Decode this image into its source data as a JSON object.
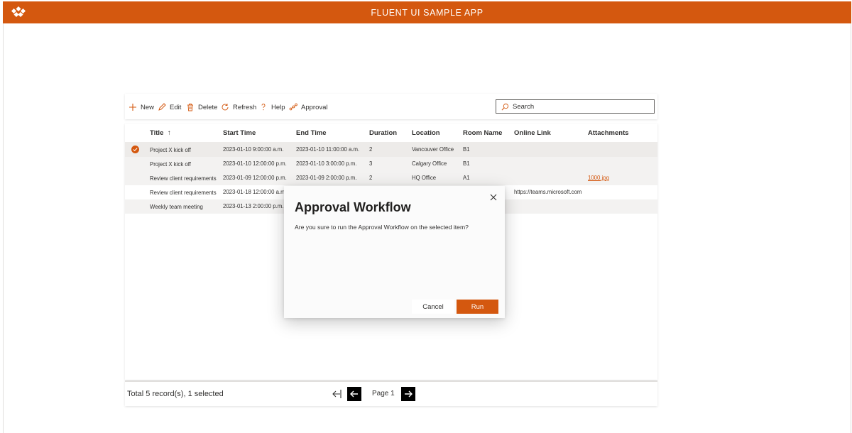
{
  "app": {
    "title": "FLUENT UI SAMPLE APP",
    "logo_icon": "brand-logo-icon",
    "accent_color": "#d4580f"
  },
  "toolbar": {
    "commands": [
      {
        "label": "New",
        "icon": "add-icon"
      },
      {
        "label": "Edit",
        "icon": "edit-icon"
      },
      {
        "label": "Delete",
        "icon": "delete-icon"
      },
      {
        "label": "Refresh",
        "icon": "refresh-icon"
      },
      {
        "label": "Help",
        "icon": "help-icon"
      },
      {
        "label": "Approval",
        "icon": "approval-icon"
      }
    ],
    "search": {
      "placeholder": "Search",
      "value": "",
      "icon": "search-icon"
    }
  },
  "grid": {
    "columns": [
      "Title",
      "Start Time",
      "End Time",
      "Duration",
      "Location",
      "Room Name",
      "Online Link",
      "Attachments"
    ],
    "sort_indicator": "↑",
    "rows": [
      {
        "title": "Project X kick off",
        "start": "2023-01-10 9:00:00 a.m.",
        "end": "2023-01-10 11:00:00 a.m.",
        "duration": "2",
        "location": "Vancouver Office",
        "room": "B1",
        "link": "",
        "attachment": "",
        "selected": true
      },
      {
        "title": "Project X kick off",
        "start": "2023-01-10 12:00:00 p.m.",
        "end": "2023-01-10 3:00:00 p.m.",
        "duration": "3",
        "location": "Calgary Office",
        "room": "B1",
        "link": "",
        "attachment": "",
        "selected": false
      },
      {
        "title": "Review client requirements",
        "start": "2023-01-09 12:00:00 p.m.",
        "end": "2023-01-09 2:00:00 p.m.",
        "duration": "2",
        "location": "HQ Office",
        "room": "A1",
        "link": "",
        "attachment": "1000.jpg",
        "selected": false
      },
      {
        "title": "Review client requirements",
        "start": "2023-01-18 12:00:00 a.m.",
        "end": "",
        "duration": "",
        "location": "",
        "room": "",
        "link": "https://teams.microsoft.com",
        "attachment": "",
        "selected": false
      },
      {
        "title": "Weekly team meeting",
        "start": "2023-01-13 2:00:00 p.m.",
        "end": "",
        "duration": "",
        "location": "",
        "room": "",
        "link": "",
        "attachment": "",
        "selected": false
      }
    ]
  },
  "footer": {
    "summary": "Total 5 record(s), 1 selected",
    "page_label": "Page 1"
  },
  "dialog": {
    "title": "Approval Workflow",
    "message": "Are you sure to run the Approval Workflow on the selected item?",
    "cancel_label": "Cancel",
    "run_label": "Run"
  }
}
